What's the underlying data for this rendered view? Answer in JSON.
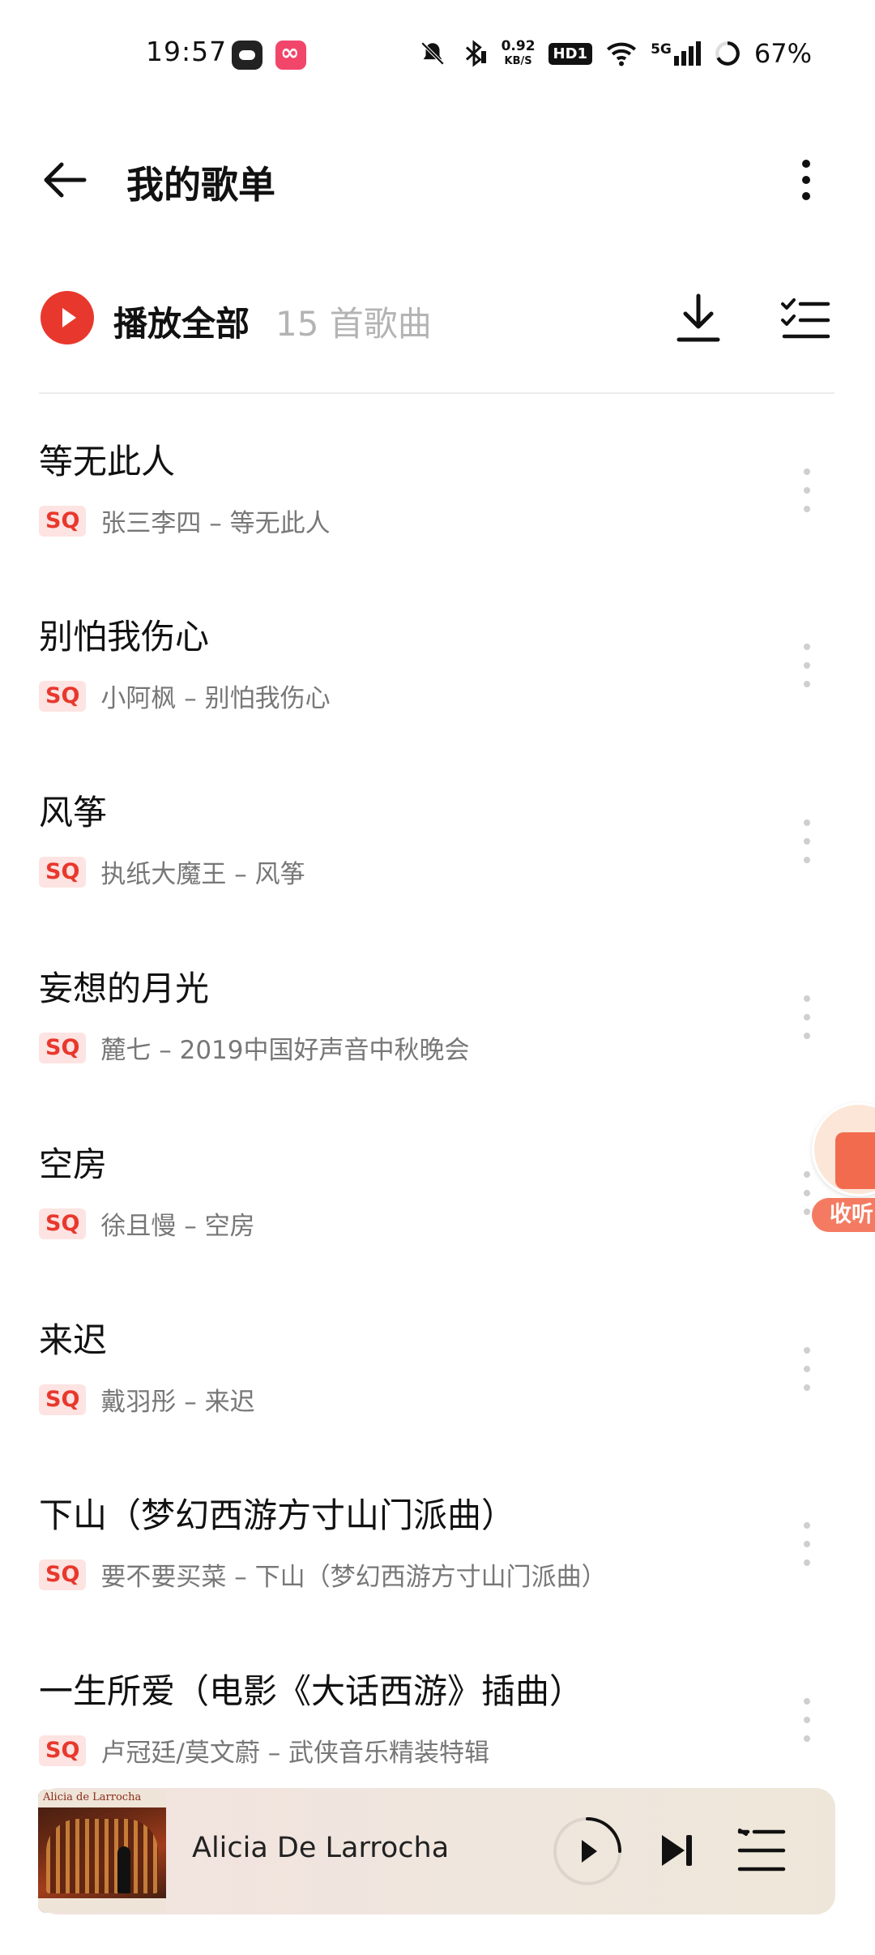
{
  "status_bar": {
    "time": "19:57",
    "net_speed_value": "0.92",
    "net_speed_unit": "KB/S",
    "hd_label": "HD1",
    "signal_label": "5G",
    "battery": "67%"
  },
  "header": {
    "title": "我的歌单"
  },
  "toolbar": {
    "play_all_label": "播放全部",
    "song_count": "15 首歌曲"
  },
  "quality_badge": "SQ",
  "songs": [
    {
      "title": "等无此人",
      "subtitle": "张三李四 – 等无此人"
    },
    {
      "title": "别怕我伤心",
      "subtitle": "小阿枫 – 别怕我伤心"
    },
    {
      "title": "风筝",
      "subtitle": "执纸大魔王 – 风筝"
    },
    {
      "title": "妄想的月光",
      "subtitle": "麓七 – 2019中国好声音中秋晚会"
    },
    {
      "title": "空房",
      "subtitle": "徐且慢 – 空房"
    },
    {
      "title": "来迟",
      "subtitle": "戴羽彤 – 来迟"
    },
    {
      "title": "下山（梦幻西游方寸山门派曲）",
      "subtitle": "要不要买菜 – 下山（梦幻西游方寸山门派曲）"
    },
    {
      "title": "一生所爱（电影《大话西游》插曲）",
      "subtitle": "卢冠廷/莫文蔚 – 武侠音乐精装特辑"
    }
  ],
  "floating_widget": {
    "label": "收听"
  },
  "mini_player": {
    "title": "Alicia De Larrocha",
    "album_art_text": "Alicia de Larrocha"
  },
  "colors": {
    "accent": "#e8382d",
    "badge_bg": "#fde3e1",
    "secondary_text": "#777777",
    "count_text": "#b4b4b4"
  }
}
